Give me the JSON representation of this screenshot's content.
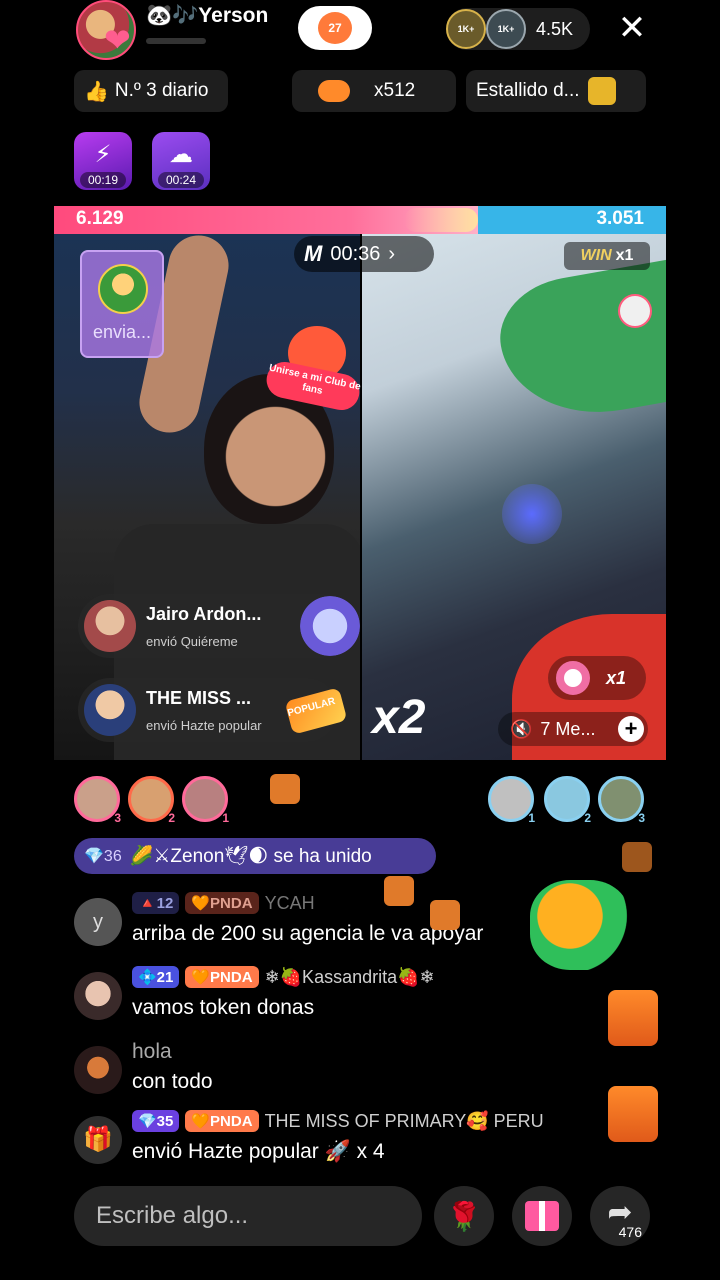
{
  "header": {
    "host_name": "🐼🎶Yerson",
    "likes_count": "27",
    "viewer_badge_1": "1K+",
    "viewer_badge_2": "1K+",
    "viewer_count": "4.5K",
    "close_glyph": "✕"
  },
  "pills": {
    "daily_rank": "N.º 3 diario",
    "daily_rank_icon": "👍",
    "multiplier": "x512",
    "burst": "Estallido d..."
  },
  "timers": [
    {
      "time": "00:19",
      "glyph": "⚡"
    },
    {
      "time": "00:24",
      "glyph": "☁"
    }
  ],
  "battle": {
    "score_left": "6.129",
    "score_right": "3.051",
    "score_left_fraction": 0.693,
    "timer_logo": "M",
    "timer": "00:36",
    "timer_chevron": "›",
    "win_label": "WIN",
    "win_mult": "x1",
    "invite_label": "envia...",
    "fanclub_text": "Unirse a mi Club de fans",
    "multiplier_big": "x2",
    "donut_mult": "x1",
    "mute_icon": "🔇",
    "mute_label": "7 Me...",
    "add_glyph": "+"
  },
  "gift_notes": [
    {
      "name": "Jairo Ardon...",
      "sub": "envió  Quiéreme"
    },
    {
      "name": "THE MISS ...",
      "sub": "envió  Hazte popular",
      "art_text": "POPULAR"
    }
  ],
  "rankers_left": [
    {
      "n": "3"
    },
    {
      "n": "2"
    },
    {
      "n": "1"
    }
  ],
  "rankers_right": [
    {
      "n": "1"
    },
    {
      "n": "2"
    },
    {
      "n": "3"
    }
  ],
  "joined": {
    "level": "💎36",
    "text": "🌽⚔Zenon🕊🌒 se ha unido"
  },
  "chat": [
    {
      "avatar_letter": "y",
      "level": "🔺12",
      "badge": "🧡PNDA",
      "user": "YCAH",
      "text": "arriba de 200 su agencia le va apoyar"
    },
    {
      "level": "💠21",
      "badge": "🧡PNDA",
      "user": "❄🍓Kassandrita🍓❄",
      "text": "vamos token donas"
    },
    {
      "user": "hola",
      "text": "con todo"
    },
    {
      "avatar_icon": "🎁",
      "level": "💎35",
      "badge": "🧡PNDA",
      "user": "THE MISS OF PRIMARY🥰 PERU",
      "text": "envió Hazte popular 🚀 x 4"
    }
  ],
  "bottom": {
    "input_placeholder": "Escribe algo...",
    "rose_icon": "🌹",
    "share_icon": "➦",
    "share_count": "476"
  },
  "colors": {
    "score_left": "#ff4a7d",
    "score_right": "#37b5e8",
    "joined_bg": "#6050c8",
    "pnda_badge": "#ff7a4a"
  }
}
